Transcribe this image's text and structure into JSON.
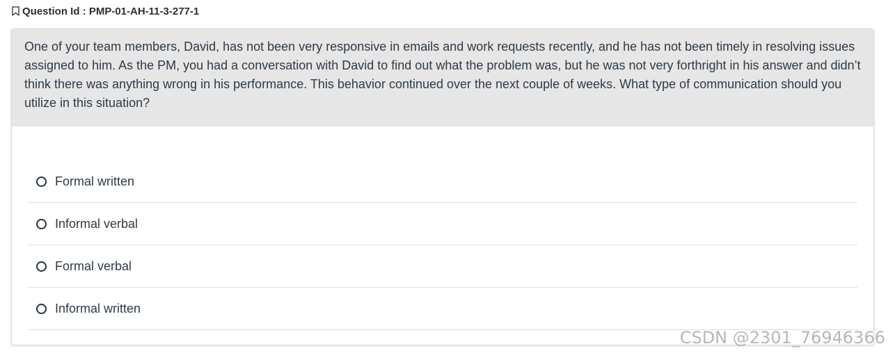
{
  "question_id": {
    "label": "Question Id : PMP-01-AH-11-3-277-1",
    "icon": "bookmark-icon"
  },
  "question": {
    "text": "One of your team members, David, has not been very responsive in emails and work requests recently, and he has not been timely in resolving issues assigned to him. As the PM, you had a conversation with David to find out what the problem was, but he was not very forthright in his answer and didn’t think there was anything wrong in his performance. This behavior continued over the next couple of weeks. What type of communication should you utilize in this situation?"
  },
  "options": [
    {
      "label": "Formal written",
      "selected": false
    },
    {
      "label": "Informal verbal",
      "selected": false
    },
    {
      "label": "Formal verbal",
      "selected": false
    },
    {
      "label": "Informal written",
      "selected": false
    }
  ],
  "watermark": "CSDN @2301_76946366",
  "colors": {
    "question_background": "#e6e6e6",
    "text": "#2e3a46",
    "divider": "#dddddd"
  }
}
